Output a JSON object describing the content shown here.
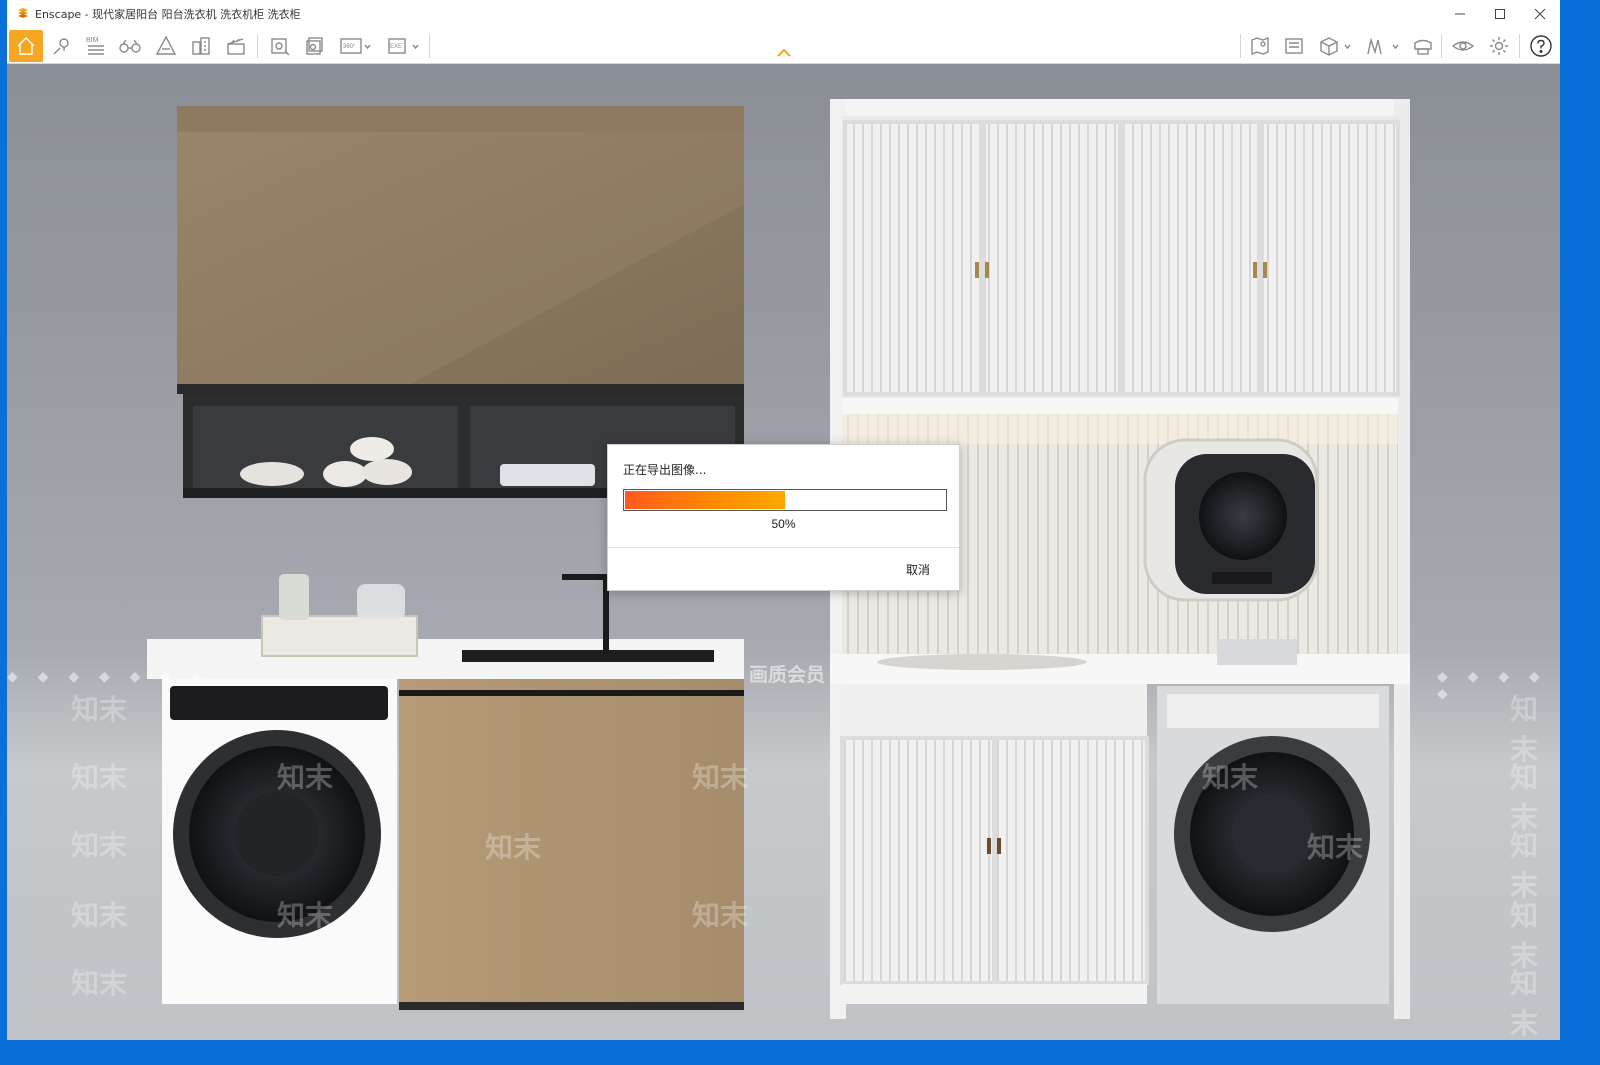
{
  "window": {
    "title": "Enscape - 现代家居阳台 阳台洗衣机 洗衣机柜 洗衣柜",
    "minimize_icon": "minimize-icon",
    "maximize_icon": "maximize-icon",
    "close_icon": "close-icon"
  },
  "toolbar": {
    "left_icons": [
      "home-icon",
      "map-pin-icon",
      "bim-icon",
      "binoculars-icon",
      "atmosphere-icon",
      "asset-library-icon",
      "clapper-icon",
      "screenshot-icon",
      "batch-render-icon",
      "panorama-360-icon",
      "export-exe-icon"
    ],
    "bim_label": "BIM",
    "pano_label": "360°",
    "exe_label": "EXE",
    "right_icons": [
      "minimap-icon",
      "views-icon",
      "cube-icon",
      "sketch-icon",
      "vr-headset-icon",
      "eye-icon",
      "settings-gear-icon",
      "help-icon"
    ]
  },
  "viewport": {
    "watermark_text": "知末",
    "quality_text": "画质会员"
  },
  "export_dialog": {
    "title": "正在导出图像...",
    "progress": 0.5,
    "progress_label": "50%",
    "cancel_label": "取消"
  },
  "colors": {
    "accent_orange": "#f5a623",
    "progress_start": "#ff5a1f",
    "progress_end": "#ffa800",
    "desktop_blue": "#0a6fd8"
  }
}
